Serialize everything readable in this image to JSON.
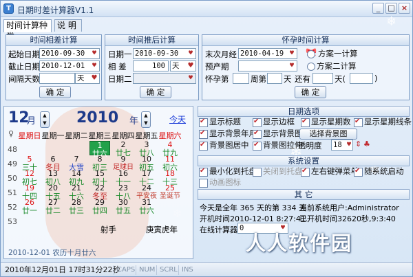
{
  "window": {
    "title": "日期时差计算器V1.1",
    "icon_text": "T",
    "minimize": "_",
    "maximize": "□",
    "close": "×"
  },
  "tabs": [
    {
      "label": "时间计算种类"
    },
    {
      "label": "说 明"
    }
  ],
  "diff": {
    "title": "时间相差计算",
    "start_label": "起始日期",
    "start_value": "2010-09-30",
    "end_label": "截止日期",
    "end_value": "2010-12-01",
    "interval_label": "间隔天数",
    "interval_value": "",
    "unit": "天",
    "ok": "确 定"
  },
  "shift": {
    "title": "时间推后计算",
    "date1_label": "日期一",
    "date1_value": "2010-09-30",
    "diff_label": "相 差",
    "diff_value": "100",
    "unit": "天",
    "date2_label": "日期二",
    "date2_value": "",
    "ok": "确 定"
  },
  "preg": {
    "title": "怀孕时间计算",
    "last_label": "末次月经",
    "last_value": "2010-04-19",
    "plan1": "方案一计算",
    "plan2": "方案二计算",
    "due_label": "预产期",
    "due_value": "",
    "week_prefix": "怀孕第",
    "week_label": "周第",
    "day_label": "天",
    "remain_label": "还有",
    "day2_label": "天(",
    "close_paren": ")",
    "ok": "确 定"
  },
  "calendar": {
    "month": "12",
    "month_unit": "月",
    "year": "2010",
    "year_unit": "年",
    "today": "今天",
    "week_col_icon": "♀",
    "weekdays": [
      "星期日",
      "星期一",
      "星期二",
      "星期三",
      "星期四",
      "星期五",
      "星期六"
    ],
    "weeks": [
      "48",
      "49",
      "50",
      "51",
      "52",
      "53"
    ],
    "rows": [
      [
        [
          "",
          ""
        ],
        [
          "",
          ""
        ],
        [
          "",
          ""
        ],
        [
          "1",
          "廿六"
        ],
        [
          "2",
          "廿七"
        ],
        [
          "3",
          "廿八"
        ],
        [
          "4",
          "廿九"
        ]
      ],
      [
        [
          "5",
          "三十"
        ],
        [
          "6",
          "冬月"
        ],
        [
          "7",
          "大雪"
        ],
        [
          "8",
          "初三"
        ],
        [
          "9",
          "足球日"
        ],
        [
          "10",
          "初五"
        ],
        [
          "11",
          "初六"
        ]
      ],
      [
        [
          "12",
          "初七"
        ],
        [
          "13",
          "初八"
        ],
        [
          "14",
          "初九"
        ],
        [
          "15",
          "初十"
        ],
        [
          "16",
          "十一"
        ],
        [
          "17",
          "十二"
        ],
        [
          "18",
          "十三"
        ]
      ],
      [
        [
          "19",
          "十四"
        ],
        [
          "20",
          "十五"
        ],
        [
          "21",
          "十六"
        ],
        [
          "22",
          "冬至"
        ],
        [
          "23",
          "十八"
        ],
        [
          "24",
          "平安夜"
        ],
        [
          "25",
          "圣诞节"
        ]
      ],
      [
        [
          "26",
          "廿一"
        ],
        [
          "27",
          "廿二"
        ],
        [
          "28",
          "廿三"
        ],
        [
          "29",
          "廿四"
        ],
        [
          "30",
          "廿五"
        ],
        [
          "31",
          "廿六"
        ],
        [
          "",
          ""
        ]
      ],
      [
        [
          "",
          ""
        ],
        [
          "",
          ""
        ],
        [
          "",
          ""
        ],
        [
          "",
          ""
        ],
        [
          "",
          ""
        ],
        [
          "",
          ""
        ],
        [
          "",
          ""
        ]
      ]
    ],
    "zodiac": "射手",
    "ganzhi": "庚寅虎年",
    "footer": "2010-12-01  农历十月廿六"
  },
  "date_options": {
    "title": "日期选项",
    "items": [
      {
        "label": "显示标题",
        "checked": true
      },
      {
        "label": "显示边框",
        "checked": true
      },
      {
        "label": "显示星期数",
        "checked": true
      },
      {
        "label": "显示星期线条",
        "checked": true
      },
      {
        "label": "显示背景年月",
        "checked": true
      },
      {
        "label": "显示背景图",
        "checked": true
      },
      {
        "label": "背景图居中",
        "checked": true
      },
      {
        "label": "背景图拉伸",
        "checked": true
      }
    ],
    "choose_bg": "选择背景图",
    "opacity_label": "透明度",
    "opacity_value": "18"
  },
  "system": {
    "title": "系统设置",
    "items": [
      {
        "label": "最小化到托盘",
        "checked": true
      },
      {
        "label": "关闭到托盘",
        "checked": false
      },
      {
        "label": "左右键弹菜单",
        "checked": true
      },
      {
        "label": "随系统启动",
        "checked": true
      },
      {
        "label": "动画图标",
        "checked": false
      }
    ]
  },
  "other": {
    "title": "其 它",
    "line1": "今天是全年 365 天的第 334 天",
    "user": "当前系统用户:Administrator",
    "boot": "开机时间2010-12-01   8:27:41",
    "uptime": "已开机时间32620秒,9:3:40",
    "calc_label": "在线计算器",
    "calc_value": "0"
  },
  "status": {
    "datetime": "2010年12月01日 17时31分22秒",
    "caps": "CAPS",
    "num": "NUM",
    "scrl": "SCRL",
    "ins": "INS"
  },
  "watermark": "人人软件园"
}
